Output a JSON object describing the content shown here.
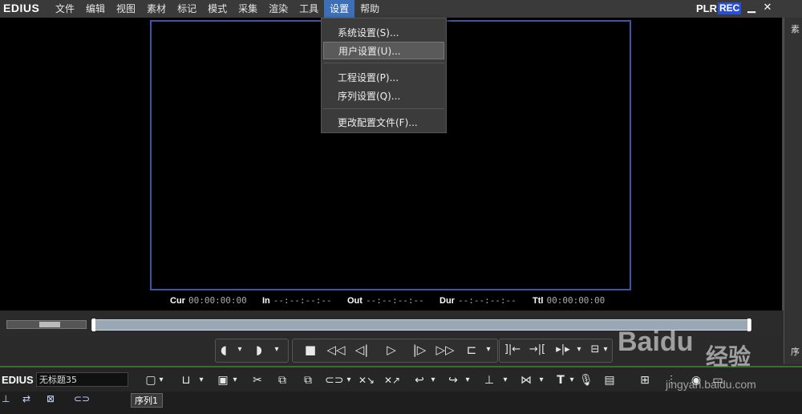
{
  "app": {
    "brand": "EDIUS",
    "plr": "PLR",
    "rec": "REC"
  },
  "menubar": {
    "items": [
      "文件",
      "编辑",
      "视图",
      "素材",
      "标记",
      "模式",
      "采集",
      "渲染",
      "工具",
      "设置",
      "帮助"
    ],
    "active": "设置"
  },
  "window_buttons": {
    "minimize": "▁",
    "close": "✕"
  },
  "settings_menu": {
    "items": [
      "系统设置(S)...",
      "用户设置(U)...",
      "工程设置(P)...",
      "序列设置(Q)...",
      "更改配置文件(F)..."
    ],
    "highlighted": "用户设置(U)..."
  },
  "timecodes": {
    "cur_label": "Cur",
    "cur_value": "00:00:00:00",
    "in_label": "In",
    "in_value": "--:--:--:--",
    "out_label": "Out",
    "out_value": "--:--:--:--",
    "dur_label": "Dur",
    "dur_value": "--:--:--:--",
    "ttl_label": "Ttl",
    "ttl_value": "00:00:00:00"
  },
  "right_strip": {
    "top_label": "素",
    "bottom_label": "序"
  },
  "timeline_toolbar": {
    "brand": "EDIUS",
    "project_name": "无标题35"
  },
  "tabs": {
    "sequence": "序列1"
  },
  "watermark": {
    "logo": "Bai",
    "logo2": "du",
    "cn": "经验",
    "url": "jingyan.baidu.com"
  },
  "colors": {
    "accent": "#3c6fb5",
    "frame_border": "#3a54b0",
    "rec_bg": "#2a4fd6"
  }
}
